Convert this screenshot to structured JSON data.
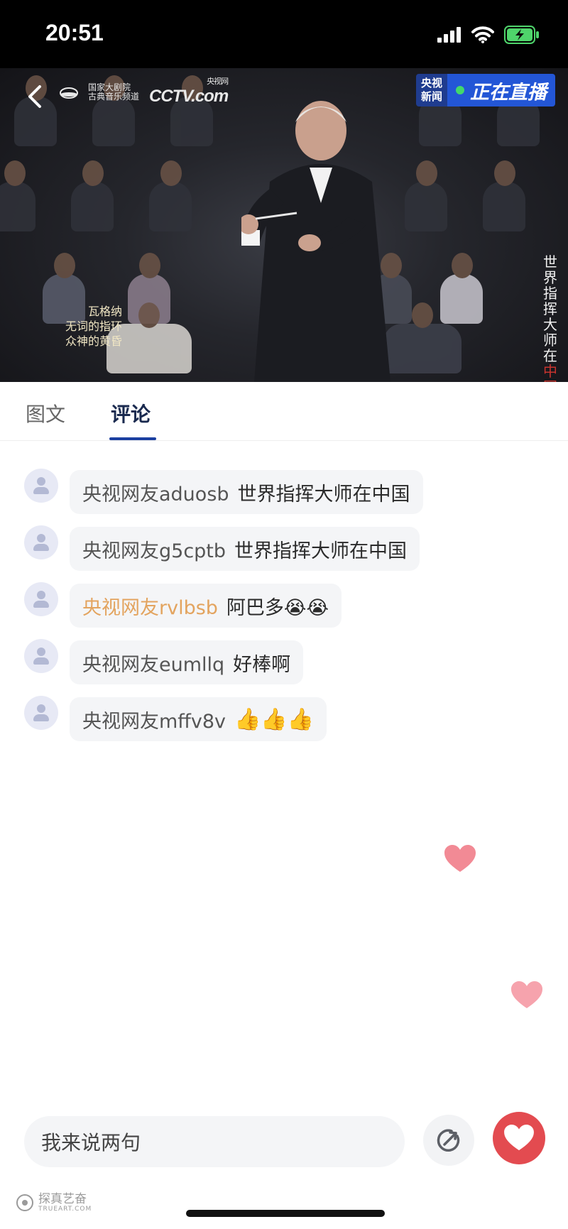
{
  "status_bar": {
    "time": "20:51"
  },
  "video": {
    "logo_line1": "国家大剧院",
    "logo_line2": "古典音乐频道",
    "cctv_logo": "CCTV.com",
    "cctv_small": "央视网",
    "live_channel_line1": "央视",
    "live_channel_line2": "新闻",
    "live_status": "正在直播",
    "subtitle_line1": "瓦格纳",
    "subtitle_line2": "无词的指环",
    "subtitle_line3": "众神的黄昏",
    "vertical_title": "世界指挥大师在",
    "vertical_title_red": "中国"
  },
  "tabs": [
    {
      "label": "图文",
      "active": false
    },
    {
      "label": "评论",
      "active": true
    }
  ],
  "comments": [
    {
      "user": "央视网友aduosb",
      "text": "世界指挥大师在中国",
      "highlight": false
    },
    {
      "user": "央视网友g5cptb",
      "text": "世界指挥大师在中国",
      "highlight": false
    },
    {
      "user": "央视网友rvlbsb",
      "text": "阿巴多😭😭",
      "highlight": true
    },
    {
      "user": "央视网友eumllq",
      "text": "好棒啊",
      "highlight": false
    },
    {
      "user": "央视网友mffv8v",
      "text": "👍👍👍",
      "highlight": false
    }
  ],
  "input": {
    "placeholder": "我来说两句"
  },
  "watermark": {
    "title": "探真艺奋",
    "sub": "TRUEART.COM"
  },
  "colors": {
    "accent": "#1b3fa0",
    "like": "#e34b50",
    "heart_float": "#f28a95",
    "highlight_user": "#e3a45f"
  },
  "icons": [
    "back-arrow-icon",
    "signal-icon",
    "wifi-icon",
    "battery-icon",
    "share-icon",
    "heart-icon"
  ]
}
